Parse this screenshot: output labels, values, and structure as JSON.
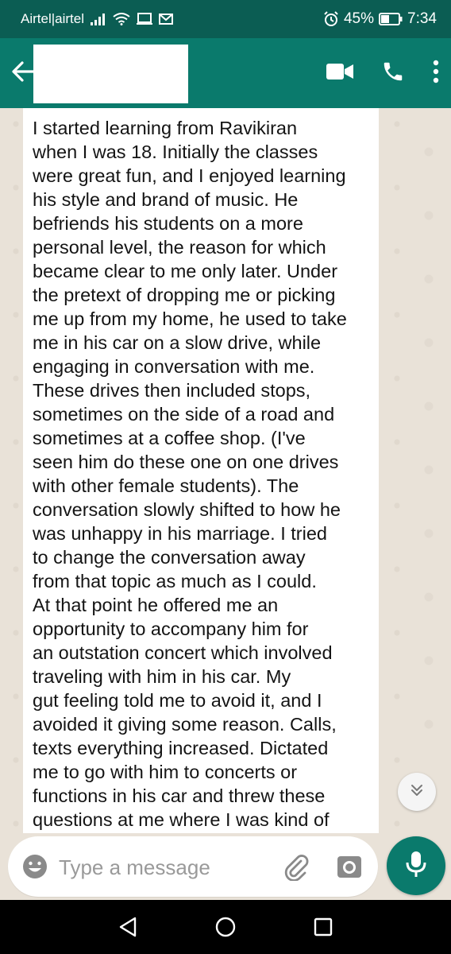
{
  "status_bar": {
    "carrier": "Airtel|airtel",
    "battery": "45%",
    "time": "7:34"
  },
  "header": {
    "contact_name": ""
  },
  "chat": {
    "message": "I started learning from Ravikiran\nwhen I was 18. Initially the classes\nwere great fun, and I enjoyed learning\nhis style and brand of music. He\nbefriends his students on a more\npersonal level, the reason for which\nbecame clear to me only later. Under\nthe pretext of dropping me or picking\nme up from my home, he used to take\nme in his car on a slow drive, while\nengaging in conversation with me.\nThese drives then included stops,\nsometimes on the side of a road and\nsometimes at a coffee shop. (I've\nseen him do these one on one drives\nwith other female students). The\nconversation slowly shifted to how he\nwas unhappy in his marriage. I tried\nto change the conversation away\nfrom that topic as much as I could.\nAt that point he offered me an\nopportunity to accompany him for\nan outstation concert which involved\ntraveling with him in his car. My\ngut feeling told me to avoid it, and I\navoided it giving some reason. Calls,\ntexts everything increased. Dictated\nme to go with him to concerts or\nfunctions in his car and threw these\nquestions at me where I was kind of"
  },
  "composer": {
    "placeholder": "Type a message",
    "value": ""
  },
  "icons": {
    "back": "arrow-left-icon",
    "video_call": "video-camera-icon",
    "voice_call": "phone-icon",
    "menu": "more-vertical-icon",
    "emoji": "emoji-icon",
    "attach": "paperclip-icon",
    "camera": "camera-icon",
    "mic": "microphone-icon",
    "scroll_down": "double-chevron-down-icon"
  },
  "colors": {
    "status_bar": "#0b5d53",
    "app_bar": "#0a7a6c",
    "accent": "#0a7a6c",
    "chat_background": "#e9e2d8",
    "bubble": "#ffffff"
  }
}
